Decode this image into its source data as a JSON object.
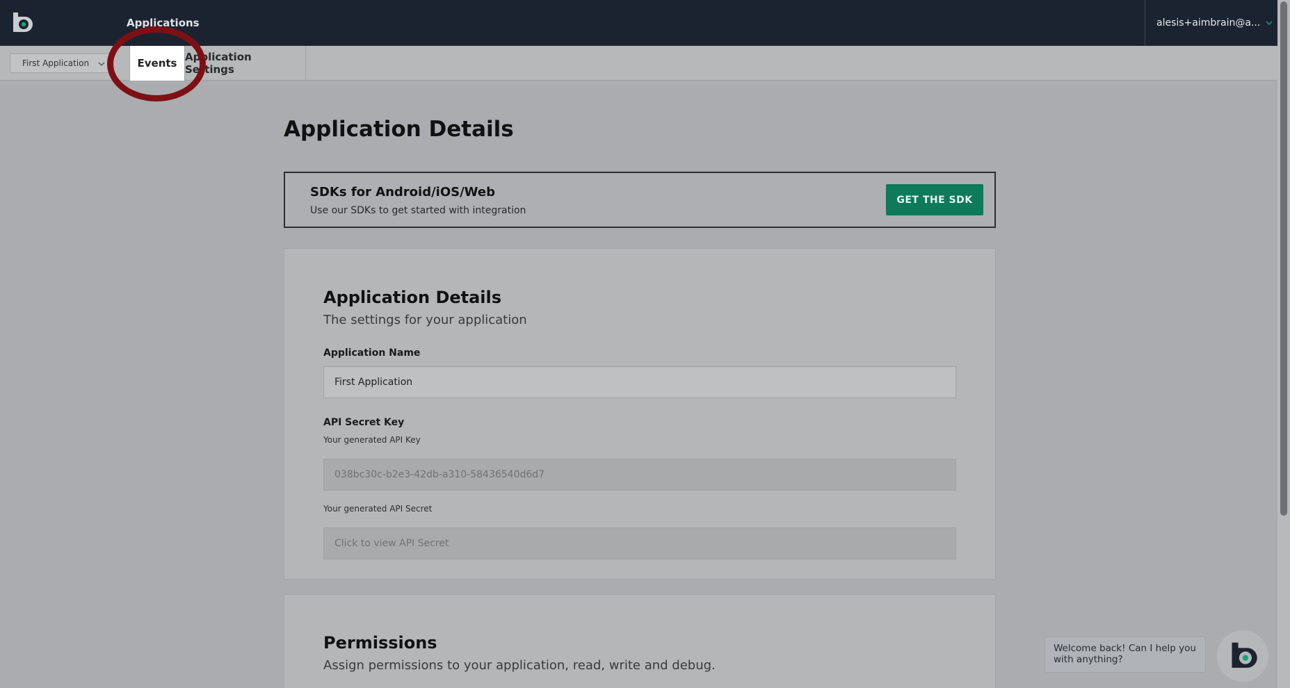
{
  "topbar": {
    "nav_applications": "Applications",
    "user_email": "alesis+aimbrain@a..."
  },
  "subbar": {
    "app_selector": "First Application",
    "tabs": [
      {
        "label": "Events"
      },
      {
        "label": "Application Settings"
      }
    ]
  },
  "page": {
    "title": "Application Details"
  },
  "sdk_card": {
    "title": "SDKs for Android/iOS/Web",
    "subtitle": "Use our SDKs to get started with integration",
    "button": "GET THE SDK"
  },
  "details_card": {
    "heading": "Application Details",
    "subheading": "The settings for your application",
    "app_name_label": "Application Name",
    "app_name_value": "First Application",
    "api_secret_key_label": "API Secret Key",
    "api_key_hint": "Your generated API Key",
    "api_key_value": "038bc30c-b2e3-42db-a310-58436540d6d7",
    "api_secret_hint": "Your generated API Secret",
    "api_secret_value": "Click to view API Secret"
  },
  "permissions_card": {
    "heading": "Permissions",
    "subheading": "Assign permissions to your application, read, write and debug."
  },
  "chat": {
    "message": "Welcome back! Can I help you with anything?"
  },
  "colors": {
    "topbar": "#1c2330",
    "accent": "#0d7a5a",
    "logo_dot": "#17a37a",
    "highlight_ring": "#7e1015"
  }
}
